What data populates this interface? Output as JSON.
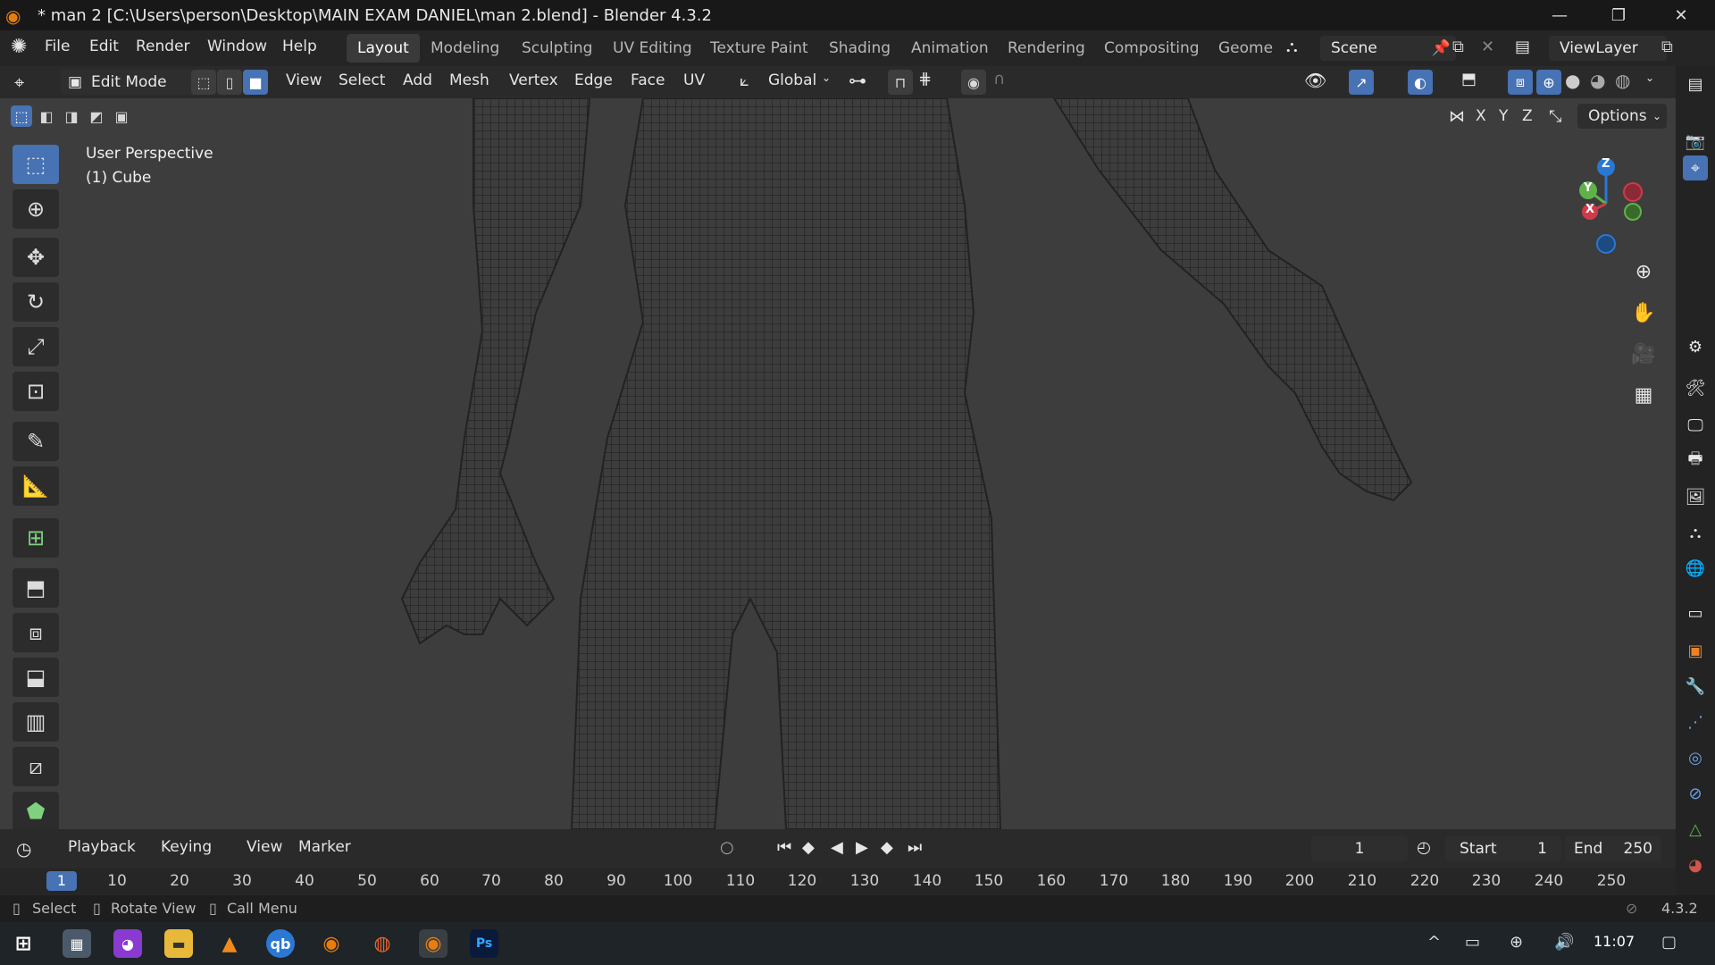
{
  "window": {
    "title": "* man 2 [C:\\Users\\person\\Desktop\\MAIN EXAM DANIEL\\man 2.blend] - Blender 4.3.2",
    "minimize": "—",
    "restore": "❐",
    "close": "✕"
  },
  "menu": {
    "file": "File",
    "edit": "Edit",
    "render": "Render",
    "window": "Window",
    "help": "Help"
  },
  "workspaces": [
    "Layout",
    "Modeling",
    "Sculpting",
    "UV Editing",
    "Texture Paint",
    "Shading",
    "Animation",
    "Rendering",
    "Compositing",
    "Geome"
  ],
  "scene": {
    "name": "Scene",
    "view_layer": "ViewLayer"
  },
  "header": {
    "mode": "Edit Mode",
    "view": "View",
    "select": "Select",
    "add": "Add",
    "mesh": "Mesh",
    "vertex": "Vertex",
    "edge": "Edge",
    "face": "Face",
    "uv": "UV",
    "transform_orientation": "Global",
    "axis_x": "X",
    "axis_y": "Y",
    "axis_z": "Z",
    "options": "Options"
  },
  "viewport": {
    "perspective": "User Perspective",
    "object": "(1) Cube",
    "gizmo_z": "Z",
    "gizmo_y": "Y",
    "gizmo_x": "X"
  },
  "timeline": {
    "playback": "Playback",
    "keying": "Keying",
    "view": "View",
    "marker": "Marker",
    "current_frame": "1",
    "start_label": "Start",
    "start": "1",
    "end_label": "End",
    "end": "250",
    "ruler_current": "1",
    "ticks": [
      "10",
      "20",
      "30",
      "40",
      "50",
      "60",
      "70",
      "80",
      "90",
      "100",
      "110",
      "120",
      "130",
      "140",
      "150",
      "160",
      "170",
      "180",
      "190",
      "200",
      "210",
      "220",
      "230",
      "240",
      "250"
    ]
  },
  "status": {
    "select": "Select",
    "rotate": "Rotate View",
    "call_menu": "Call Menu",
    "version": "4.3.2"
  },
  "taskbar": {
    "time": "11:07"
  }
}
